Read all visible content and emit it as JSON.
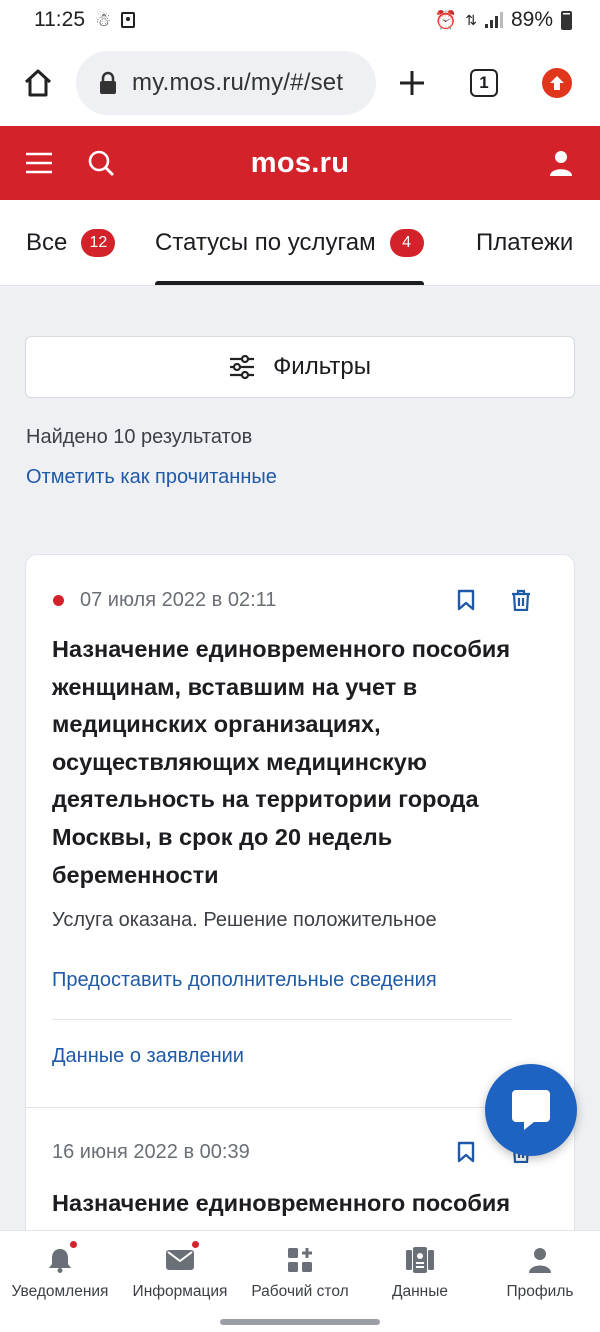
{
  "status_bar": {
    "time": "11:25",
    "battery": "89%"
  },
  "browser": {
    "url": "my.mos.ru/my/#/set",
    "tab_count": "1"
  },
  "header": {
    "title": "mos.ru"
  },
  "tabs": [
    {
      "label": "Все",
      "badge": "12"
    },
    {
      "label": "Статусы по услугам",
      "badge": "4"
    },
    {
      "label": "Платежи"
    }
  ],
  "filters": {
    "label": "Фильтры"
  },
  "results": {
    "found": "Найдено 10 результатов",
    "mark_read": "Отметить как прочитанные"
  },
  "items": [
    {
      "date": "07 июля 2022 в 02:11",
      "title": "Назначение единовременного пособия женщинам, вставшим на учет в медицинских организациях, осуществляющих медицинскую деятельность на территории города Москвы, в срок до 20 недель беременности",
      "status": "Услуга оказана. Решение положительное",
      "link_additional": "Предоставить дополнительные сведения",
      "link_details": "Данные о заявлении"
    },
    {
      "date": "16 июня 2022 в 00:39",
      "title": "Назначение единовременного пособия"
    }
  ],
  "bottom_nav": [
    {
      "label": "Уведомления",
      "icon": "bell-icon"
    },
    {
      "label": "Информация",
      "icon": "mail-icon"
    },
    {
      "label": "Рабочий стол",
      "icon": "dashboard-icon"
    },
    {
      "label": "Данные",
      "icon": "documents-icon"
    },
    {
      "label": "Профиль",
      "icon": "profile-icon"
    }
  ],
  "colors": {
    "brand_red": "#d3222a",
    "link_blue": "#1f5aa8",
    "fab_blue": "#1e63c2"
  }
}
